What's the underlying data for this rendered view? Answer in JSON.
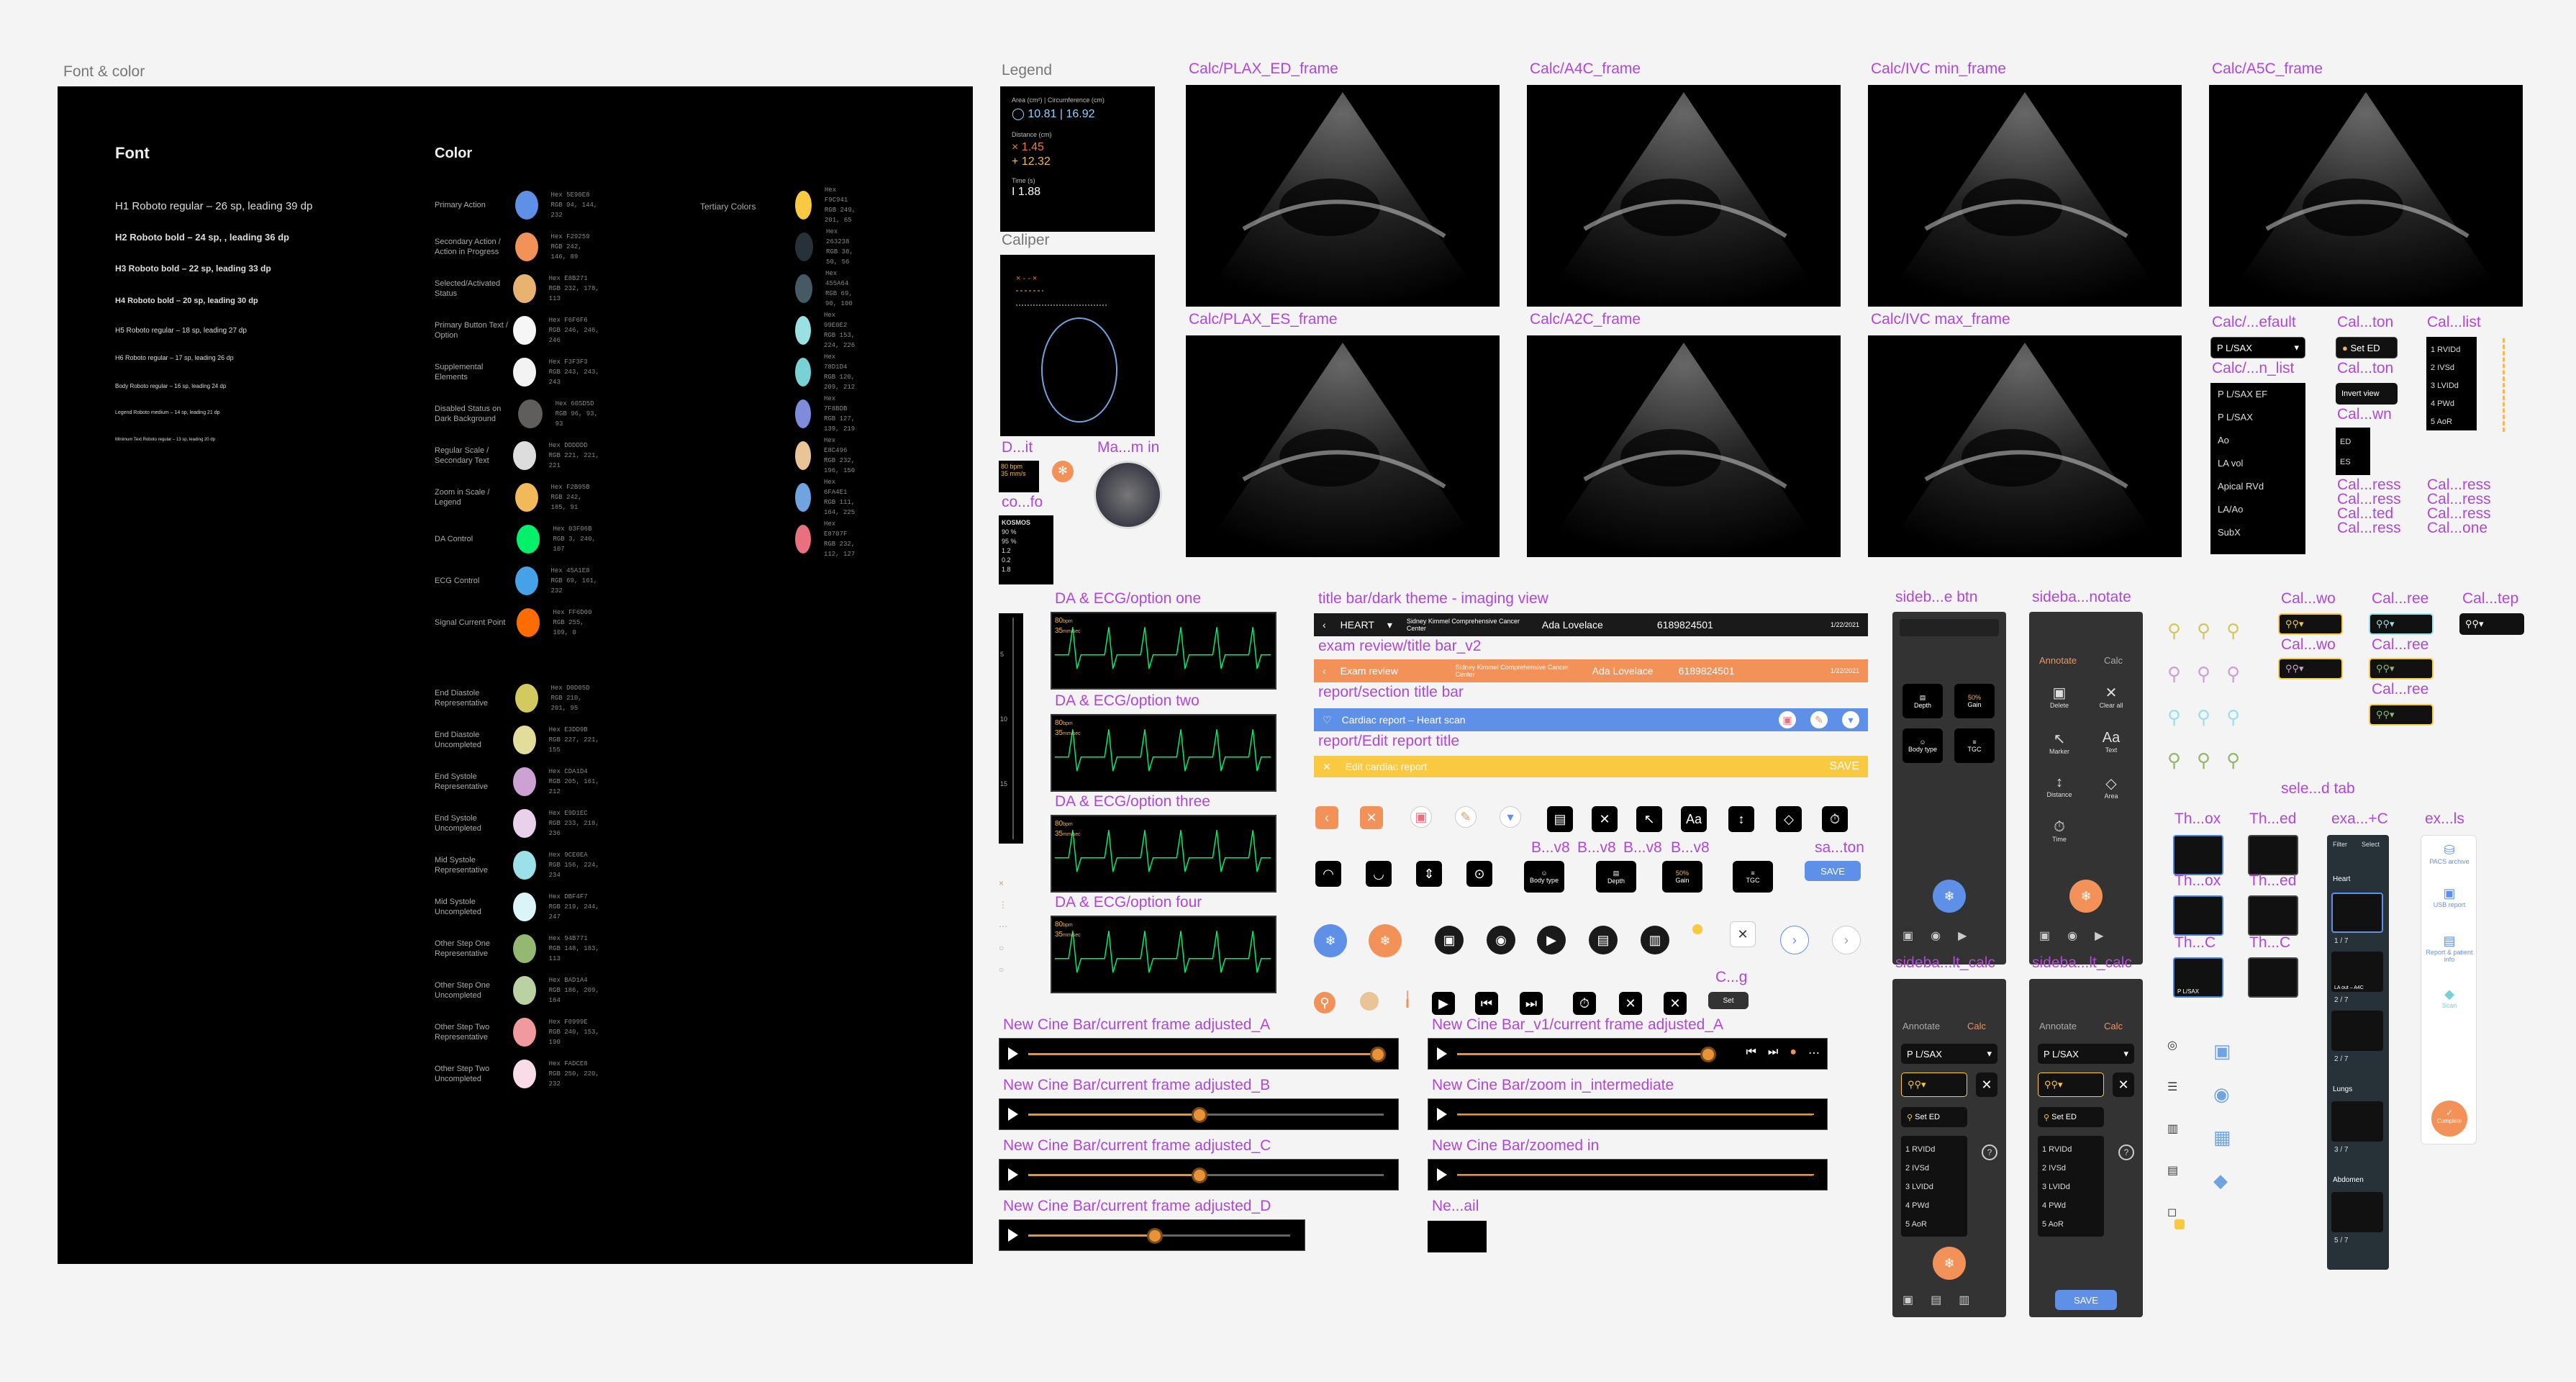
{
  "sections": {
    "font_color": "Font & color",
    "legend": "Legend",
    "caliper": "Caliper"
  },
  "font_color": {
    "font_heading": "Font",
    "color_heading": "Color",
    "tertiary_heading": "Tertiary Colors",
    "font_samples": [
      "H1  Roboto regular – 26 sp, leading 39 dp",
      "H2  Roboto bold – 24 sp, , leading 36 dp",
      "H3  Roboto bold – 22 sp, leading 33 dp",
      "H4  Roboto bold – 20 sp, leading 30 dp",
      "H5  Roboto regular – 18 sp, leading 27 dp",
      "H6  Roboto regular – 17 sp, leading 26 dp",
      "Body  Roboto regular – 16 sp, leading 24 dp",
      "Legend  Roboto medium – 14 sp, leading 21 dp",
      "Minimum Text  Roboto regular – 13 sp, leading 20 dp"
    ],
    "colors": [
      {
        "label": "Primary Action",
        "color": "#5E90E8",
        "hex": "5E90E8",
        "rgb": "94, 144, 232"
      },
      {
        "label": "Secondary Action / Action in Progress",
        "color": "#F29259",
        "hex": "F29259",
        "rgb": "242, 146, 89"
      },
      {
        "label": "Selected/Activated Status",
        "color": "#E8B271",
        "hex": "E8B271",
        "rgb": "232, 178, 113"
      },
      {
        "label": "Primary Button Text / Option",
        "color": "#F6F6F6",
        "hex": "F6F6F6",
        "rgb": "246, 246, 246"
      },
      {
        "label": "Supplemental Elements",
        "color": "#F3F3F3",
        "hex": "F3F3F3",
        "rgb": "243, 243, 243"
      },
      {
        "label": "Disabled Status on Dark Background",
        "color": "#605D5D",
        "hex": "60SD5D",
        "rgb": "96, 93, 93"
      },
      {
        "label": "Regular Scale / Secondary Text",
        "color": "#DDDDDD",
        "hex": "DDDDDD",
        "rgb": "221, 221, 221"
      },
      {
        "label": "Zoom in Scale / Legend",
        "color": "#F2B95B",
        "hex": "F2B95B",
        "rgb": "242, 185, 91"
      },
      {
        "label": "DA Control",
        "color": "#03F06B",
        "hex": "03F06B",
        "rgb": "3, 240, 107"
      },
      {
        "label": "ECG Control",
        "color": "#45A1E8",
        "hex": "45A1E8",
        "rgb": "69, 161, 232"
      },
      {
        "label": "Signal Current Point",
        "color": "#FF6D00",
        "hex": "FF6D00",
        "rgb": "255, 109, 0"
      }
    ],
    "colors2": [
      {
        "label": "End Diastole Representative",
        "color": "#D2C95F",
        "hex": "D0D05D",
        "rgb": "210, 201, 95"
      },
      {
        "label": "End Diastole Uncompleted",
        "color": "#E3DD9B",
        "hex": "E3DD9B",
        "rgb": "227, 221, 155"
      },
      {
        "label": "End Systole Representative",
        "color": "#CDA1D4",
        "hex": "CDA1D4",
        "rgb": "205, 161, 212"
      },
      {
        "label": "End Systole Uncompleted",
        "color": "#E9D1EC",
        "hex": "E9D1EC",
        "rgb": "233, 218, 236"
      },
      {
        "label": "Mid Systole Representative",
        "color": "#9CE0EA",
        "hex": "9CE0EA",
        "rgb": "156, 224, 234"
      },
      {
        "label": "Mid Systole Uncompleted",
        "color": "#DBF4F7",
        "hex": "DBF4F7",
        "rgb": "219, 244, 247"
      },
      {
        "label": "Other Step One Representative",
        "color": "#94B771",
        "hex": "94B771",
        "rgb": "148, 183, 113"
      },
      {
        "label": "Other Step One Uncompleted",
        "color": "#BAD1A4",
        "hex": "BAD1A4",
        "rgb": "186, 209, 164"
      },
      {
        "label": "Other Step Two Representative",
        "color": "#F0999E",
        "hex": "F0999E",
        "rgb": "240, 153, 190"
      },
      {
        "label": "Other Step Two Uncompleted",
        "color": "#FADCE8",
        "hex": "FADCE8",
        "rgb": "250, 220, 232"
      }
    ],
    "tertiary": [
      {
        "color": "#F9C941",
        "hex": "F9C941",
        "rgb": "249, 201, 65"
      },
      {
        "color": "#263238",
        "hex": "263238",
        "rgb": "38, 50, 56"
      },
      {
        "color": "#455A64",
        "hex": "455A64",
        "rgb": "69, 90, 100"
      },
      {
        "color": "#99E0E2",
        "hex": "99E0E2",
        "rgb": "153, 224, 226"
      },
      {
        "color": "#78D1D4",
        "hex": "78D1D4",
        "rgb": "120, 209, 212"
      },
      {
        "color": "#7F8BDB",
        "hex": "7F8BDB",
        "rgb": "127, 139, 219"
      },
      {
        "color": "#E8C496",
        "hex": "E8C496",
        "rgb": "232, 196, 150"
      },
      {
        "color": "#6FA4E1",
        "hex": "6FA4E1",
        "rgb": "111, 164, 225"
      },
      {
        "color": "#E8707F",
        "hex": "E8707F",
        "rgb": "232, 112, 127"
      }
    ]
  },
  "legend": {
    "area_label": "Area (cm²) | Circumference (cm)",
    "area_value": "10.81 | 16.92",
    "distance_label": "Distance (cm)",
    "d1": "1.45",
    "d2": "12.32",
    "time_label": "Time (s)",
    "time_value": "1.88"
  },
  "frames": [
    {
      "label": "Calc/PLAX_ED_frame"
    },
    {
      "label": "Calc/A4C_frame"
    },
    {
      "label": "Calc/IVC min_frame"
    },
    {
      "label": "Calc/A5C_frame"
    },
    {
      "label": "Calc/PLAX_ES_frame"
    },
    {
      "label": "Calc/A2C_frame"
    },
    {
      "label": "Calc/IVC max_frame"
    }
  ],
  "small_labels": {
    "d_it": "D...it",
    "ma_in": "Ma...m in",
    "co_fo": "co...fo",
    "kosmos": "KOSMOS",
    "calc_default": "Calc/...efault",
    "calc_list": "Calc/...n_list",
    "cal_ton": "Cal...ton",
    "cal_list": "Cal...list",
    "cal_ton2": "Cal...ton",
    "cal_wn": "Cal...wn",
    "cal_ress": "Cal...ress",
    "cal_ress2": "Cal...ress",
    "cal_ted": "Cal...ted",
    "cal_ress3": "Cal...ress",
    "cal_ress4": "Cal...ress",
    "cal_ress5": "Cal...ress",
    "cal_ress6": "Cal...ress",
    "cal_one": "Cal...one"
  },
  "calc_list": {
    "selected": "P L/SAX",
    "items": [
      "P L/SAX EF",
      "P L/SAX",
      "Ao",
      "LA vol",
      "Apical RVd",
      "LA/Ao",
      "SubX"
    ],
    "set_ed": "Set ED",
    "invert": "Invert view",
    "ed": "ED",
    "es": "ES",
    "measures": [
      "1 RVIDd",
      "2 IVSd",
      "3 LVIDd",
      "4 PWd",
      "5 AoR"
    ]
  },
  "ecg": {
    "labels": [
      "DA & ECG/option one",
      "DA & ECG/option two",
      "DA & ECG/option three",
      "DA & ECG/option four"
    ],
    "bpm": "80",
    "bpm_unit": "bpm",
    "mm": "35",
    "mm_unit": "mm/sec"
  },
  "titlebars": {
    "label1": "title bar/dark theme - imaging view",
    "heart": "HEART",
    "hospital": "Sidney Kimmel Comprehensive Cancer Center",
    "user": "Ada Lovelace",
    "id": "6189824501",
    "date": "1/22/2021",
    "label2": "exam review/title bar_v2",
    "exam_review": "Exam review",
    "label3": "report/section title bar",
    "cardiac": "Cardiac report – Heart scan",
    "label4": "report/Edit report title",
    "edit_cardiac": "Edit cardiac report",
    "save": "SAVE"
  },
  "buttons": {
    "b_v8": "B...v8",
    "b_v8b": "B...v8",
    "b_v8c": "B...v8",
    "b_v8d": "B...v8",
    "sa_ton": "sa...ton",
    "body_type": "Body type",
    "depth": "Depth",
    "gain": "Gain",
    "gain_val": "50%",
    "tgc": "TGC",
    "save": "SAVE",
    "aa": "Aa",
    "c_g": "C...g",
    "set": "Set"
  },
  "cine": {
    "a": "New Cine Bar/current frame adjusted_A",
    "b": "New Cine Bar/current frame adjusted_B",
    "c": "New Cine Bar/current frame adjusted_C",
    "d": "New Cine Bar/current frame adjusted_D",
    "v1": "New Cine Bar_v1/current frame adjusted_A",
    "zoom": "New Cine Bar/zoom in_intermediate",
    "zoomed": "New Cine Bar/zoomed in",
    "ne_all": "Ne...ail",
    "fill": {
      "a": 0.98,
      "b": 0.48,
      "c": 0.48,
      "d": 0.48,
      "v1": 0.98
    }
  },
  "sidebars": {
    "sideb_btn": "sideb...e btn",
    "sideba_notate": "sideba...notate",
    "sideba_calc": "sideba...lt_calc",
    "sideba_calc2": "sideba...lt_calc",
    "depth": "Depth",
    "gain": "Gain",
    "gain_val": "50%",
    "body_type": "Body type",
    "tgc": "TGC",
    "annotate": "Annotate",
    "calc": "Calc",
    "delete": "Delete",
    "clear_all": "Clear all",
    "marker": "Marker",
    "text": "Text",
    "aa": "Aa",
    "distance": "Distance",
    "area": "Area",
    "time": "Time",
    "plsax": "P L/SAX",
    "set_ed": "Set ED",
    "measures": [
      "1 RVIDd",
      "2 IVSd",
      "3 LVIDd",
      "4 PWd",
      "5 AoR"
    ],
    "save": "SAVE"
  },
  "right": {
    "cal_wo": "Cal...wo",
    "cal_ree": "Cal...ree",
    "cal_tep": "Cal...tep",
    "cal_wo2": "Cal...wo",
    "cal_ree2": "Cal...ree",
    "cal_ree3": "Cal...ree",
    "sele_tab": "sele...d tab",
    "th_ox": "Th...ox",
    "th_ed": "Th...ed",
    "th_ox2": "Th...ox",
    "th_ed2": "Th...ed",
    "th_c": "Th...C",
    "th_c2": "Th...C",
    "exa_c": "exa...+C",
    "ex_ls": "ex...ls",
    "plsax": "P L/SAX",
    "filter": "Filter",
    "select": "Select",
    "heart": "Heart",
    "lungs": "Lungs",
    "abdomen": "Abdomen",
    "pacs": "PACS archive",
    "usb": "USB report",
    "report_info": "Report & patient info",
    "scan": "Scan",
    "complete": "Complete",
    "c17": "1 / 7",
    "c27": "2 / 7",
    "c37": "3 / 7",
    "c57": "5 / 7",
    "lauuta": "LA out – A4C"
  }
}
